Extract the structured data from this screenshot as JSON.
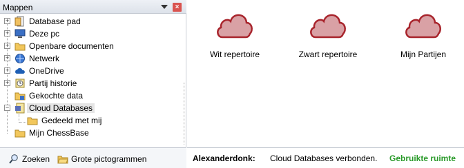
{
  "panel": {
    "title": "Mappen"
  },
  "tree": [
    {
      "label": "Database pad",
      "icon": "database-path-icon"
    },
    {
      "label": "Deze pc",
      "icon": "computer-icon"
    },
    {
      "label": "Openbare documenten",
      "icon": "folder-icon"
    },
    {
      "label": "Netwerk",
      "icon": "network-icon"
    },
    {
      "label": "OneDrive",
      "icon": "onedrive-icon"
    },
    {
      "label": "Partij historie",
      "icon": "history-icon"
    },
    {
      "label": "Gekochte data",
      "icon": "purchased-data-icon"
    },
    {
      "label": "Cloud Databases",
      "icon": "cloud-database-icon"
    },
    {
      "label": "Gedeeld met mij",
      "icon": "folder-icon"
    },
    {
      "label": "Mijn ChessBase",
      "icon": "chessbase-icon"
    }
  ],
  "toolbar": {
    "search_label": "Zoeken",
    "large_icons_label": "Grote pictogrammen"
  },
  "tiles": [
    {
      "label": "Wit repertoire"
    },
    {
      "label": "Zwart repertoire"
    },
    {
      "label": "Mijn Partijen"
    }
  ],
  "status": {
    "user": "Alexanderdonk:",
    "text": "Cloud Databases verbonden.",
    "used": "Gebruikte ruimte"
  },
  "colors": {
    "cloud_fill": "#d9a1a5",
    "cloud_stroke": "#a8242c",
    "used_space": "#2a9a2a"
  }
}
